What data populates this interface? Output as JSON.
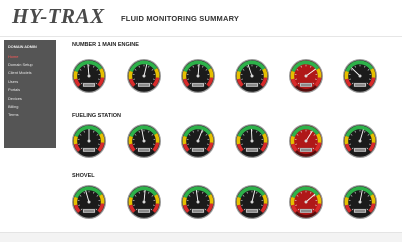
{
  "app": {
    "logo": "HY-TRAX",
    "title": "FLUID MONITORING SUMMARY"
  },
  "sidebar": {
    "header": "DOMAIN ADMIN",
    "items": [
      {
        "label": "Home",
        "active": true
      },
      {
        "label": "Domain Setup"
      },
      {
        "label": "Client Models"
      },
      {
        "label": "Users"
      },
      {
        "label": "Portals"
      },
      {
        "label": "Devices"
      },
      {
        "label": "Billing"
      },
      {
        "label": "Terms"
      }
    ]
  },
  "sections": [
    {
      "title": "NUMBER 1 MAIN ENGINE",
      "gauges": [
        {
          "face": "dark",
          "needle": 0.48
        },
        {
          "face": "dark",
          "needle": 0.55
        },
        {
          "face": "dark",
          "needle": 0.52
        },
        {
          "face": "dark",
          "needle": 0.43
        },
        {
          "face": "red",
          "needle": 0.7
        },
        {
          "face": "dark",
          "needle": 0.33
        }
      ]
    },
    {
      "title": "FUELING STATION",
      "gauges": [
        {
          "face": "dark",
          "needle": 0.5
        },
        {
          "face": "dark",
          "needle": 0.46
        },
        {
          "face": "dark",
          "needle": 0.58
        },
        {
          "face": "dark",
          "needle": 0.49
        },
        {
          "face": "red",
          "needle": 0.62
        },
        {
          "face": "dark",
          "needle": 0.56
        }
      ]
    },
    {
      "title": "SHOVEL",
      "gauges": [
        {
          "face": "dark",
          "needle": 0.44
        },
        {
          "face": "dark",
          "needle": 0.52
        },
        {
          "face": "dark",
          "needle": 0.47
        },
        {
          "face": "dark",
          "needle": 0.55
        },
        {
          "face": "red",
          "needle": 0.68
        },
        {
          "face": "dark",
          "needle": 0.54
        }
      ]
    }
  ],
  "colors": {
    "sidebar_bg": "#555555",
    "active_item": "#ff5a5a",
    "gauge_green": "#2db24a",
    "gauge_yellow": "#e6c000",
    "gauge_red": "#d82a2a"
  }
}
